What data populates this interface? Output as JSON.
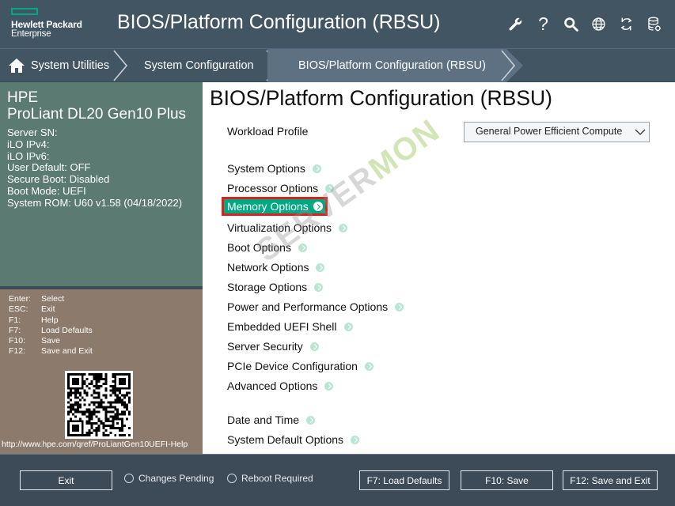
{
  "header": {
    "logo_line1": "Hewlett Packard",
    "logo_line2": "Enterprise",
    "title": "BIOS/Platform Configuration (RBSU)",
    "icons": [
      "wrench-icon",
      "help-icon",
      "search-icon",
      "globe-icon",
      "refresh-icon",
      "database-icon"
    ],
    "help_glyph": "?"
  },
  "breadcrumb": {
    "home_icon": "home-icon",
    "items": [
      "System Utilities",
      "System Configuration",
      "BIOS/Platform Configuration (RBSU)"
    ]
  },
  "server_info": {
    "brand": "HPE",
    "model": "ProLiant DL20 Gen10 Plus",
    "rows": [
      "Server SN:",
      "iLO IPv4:",
      "iLO IPv6:",
      "User Default: OFF",
      "Secure Boot: Disabled",
      "Boot Mode: UEFI",
      "System ROM: U60 v1.58 (04/18/2022)"
    ]
  },
  "keys": [
    {
      "key": "Enter:",
      "action": "Select"
    },
    {
      "key": "ESC:",
      "action": "Exit"
    },
    {
      "key": "F1:",
      "action": "Help"
    },
    {
      "key": "F7:",
      "action": "Load Defaults"
    },
    {
      "key": "F10:",
      "action": "Save"
    },
    {
      "key": "F12:",
      "action": "Save and Exit"
    }
  ],
  "help_url": "http://www.hpe.com/qref/ProLiantGen10UEFI-Help",
  "main": {
    "title": "BIOS/Platform Configuration (RBSU)",
    "workload_label": "Workload Profile",
    "workload_value": "General Power Efficient Compute",
    "menu": [
      "System Options",
      "Processor Options",
      "Memory Options",
      "Virtualization Options",
      "Boot Options",
      "Network Options",
      "Storage Options",
      "Power and Performance Options",
      "Embedded UEFI Shell",
      "Server Security",
      "PCIe Device Configuration",
      "Advanced Options",
      "Date and Time",
      "System Default Options"
    ],
    "selected_index": 2,
    "watermark_a": "SERVER",
    "watermark_b": "MON"
  },
  "footer": {
    "exit": "Exit",
    "changes_pending": "Changes Pending",
    "reboot_required": "Reboot Required",
    "load_defaults": "F7: Load Defaults",
    "save": "F10: Save",
    "save_exit": "F12: Save and Exit"
  },
  "colors": {
    "accent": "#01a982",
    "highlight_border": "#e0201b",
    "header_bg": "#425563",
    "info_bg": "#5a7a72",
    "keys_bg": "#8c7b6c"
  }
}
